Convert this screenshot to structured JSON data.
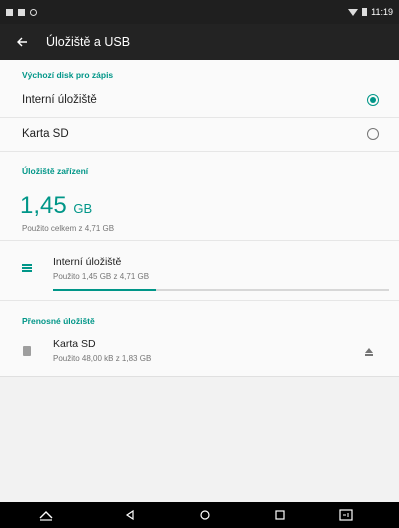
{
  "status_bar": {
    "time": "11:19"
  },
  "app_bar": {
    "title": "Úložiště a USB"
  },
  "default_disk": {
    "header": "Výchozí disk pro zápis",
    "options": [
      {
        "label": "Interní úložiště",
        "selected": true
      },
      {
        "label": "Karta SD",
        "selected": false
      }
    ]
  },
  "device_storage": {
    "header": "Úložiště zařízení",
    "used_value": "1,45",
    "used_unit": "GB",
    "used_total_text": "Použito celkem z 4,71 GB",
    "item": {
      "title": "Interní úložiště",
      "subtitle": "Použito 1,45 GB z 4,71 GB",
      "fraction_used": 0.308
    }
  },
  "portable_storage": {
    "header": "Přenosné úložiště",
    "item": {
      "title": "Karta SD",
      "subtitle": "Použito 48,00 kB z 1,83 GB"
    }
  },
  "colors": {
    "accent": "#009688",
    "app_bar": "#232323",
    "status_bar": "#1f1f1f"
  },
  "icons": [
    "back-arrow-icon",
    "storage-list-icon",
    "sd-card-icon",
    "eject-icon",
    "nav-back-icon",
    "nav-home-icon",
    "nav-recents-icon",
    "nav-keyboard-icon",
    "nav-screenshot-icon"
  ]
}
